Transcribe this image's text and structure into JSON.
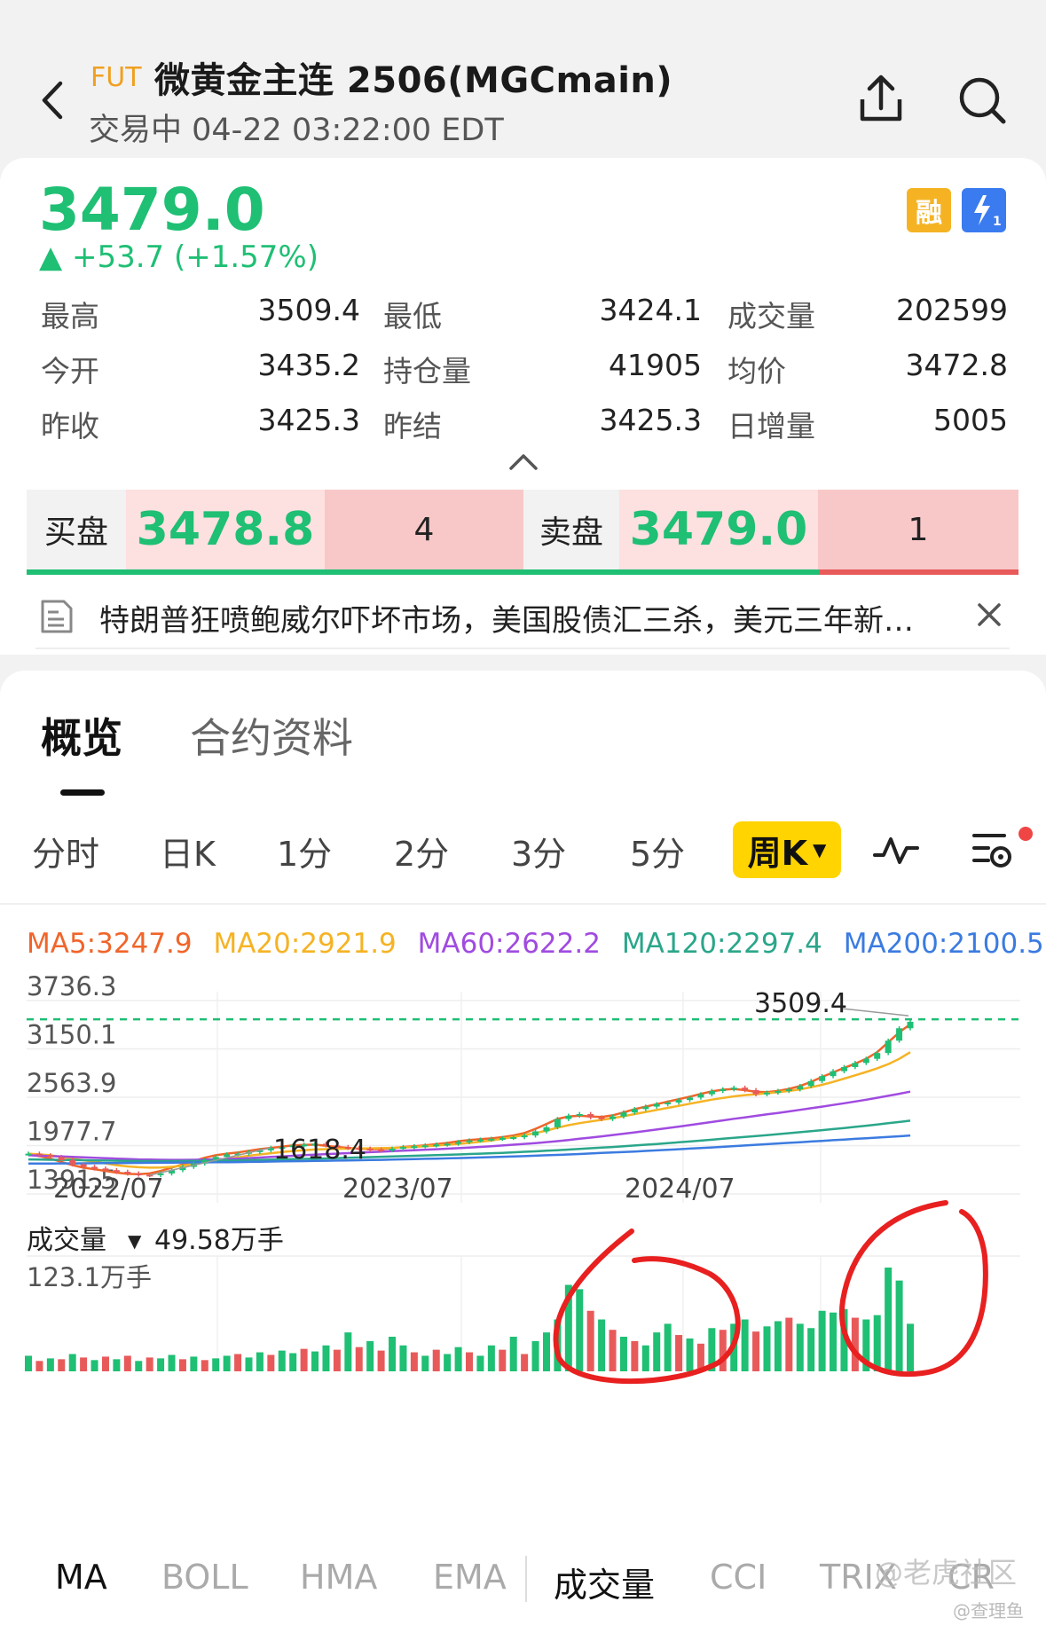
{
  "header": {
    "fut_badge": "FUT",
    "title": "微黄金主连 2506(MGCmain)",
    "status_line": "交易中 04-22 03:22:00 EDT"
  },
  "quote": {
    "last_price": "3479.0",
    "change": "▲ +53.7 (+1.57%)",
    "badge_rong": "融",
    "up_color": "#1fbf74",
    "down_color": "#e85a5a",
    "stats": [
      {
        "l1": "最高",
        "v1": "3509.4",
        "l2": "最低",
        "v2": "3424.1",
        "l3": "成交量",
        "v3": "202599"
      },
      {
        "l1": "今开",
        "v1": "3435.2",
        "l2": "持仓量",
        "v2": "41905",
        "l3": "均价",
        "v3": "3472.8"
      },
      {
        "l1": "昨收",
        "v1": "3425.3",
        "l2": "昨结",
        "v2": "3425.3",
        "l3": "日增量",
        "v3": "5005"
      }
    ]
  },
  "order_book": {
    "bid_label": "买盘",
    "bid_price": "3478.8",
    "bid_size": "4",
    "ask_label": "卖盘",
    "ask_price": "3479.0",
    "ask_size": "1"
  },
  "news": {
    "headline": "特朗普狂喷鲍威尔吓坏市场，美国股债汇三杀，美元三年新…"
  },
  "tabs": [
    "概览",
    "合约资料"
  ],
  "periods": [
    "分时",
    "日K",
    "1分",
    "2分",
    "3分",
    "5分"
  ],
  "active_period": "周K",
  "ma_legend": [
    {
      "text": "MA5:3247.9",
      "color": "#f0652a"
    },
    {
      "text": "MA20:2921.9",
      "color": "#f5b324"
    },
    {
      "text": "MA60:2622.2",
      "color": "#a04be0"
    },
    {
      "text": "MA120:2297.4",
      "color": "#2aa68a"
    },
    {
      "text": "MA200:2100.5",
      "color": "#3b7be0"
    }
  ],
  "chart_data": [
    {
      "type": "candlestick",
      "title": "",
      "y_ticks": [
        "3736.3",
        "3150.1",
        "2563.9",
        "1977.7",
        "1391.5"
      ],
      "ylim": [
        1391.5,
        3736.3
      ],
      "x_ticks": [
        "2022/07",
        "2023/07",
        "2024/07"
      ],
      "high_annotation": "3509.4",
      "low_annotation": "1618.4",
      "reference_line": 3509.4,
      "close_series": [
        1880,
        1860,
        1840,
        1800,
        1750,
        1720,
        1700,
        1680,
        1660,
        1640,
        1625,
        1620,
        1640,
        1680,
        1720,
        1760,
        1800,
        1840,
        1870,
        1880,
        1900,
        1920,
        1950,
        1960,
        1980,
        1990,
        2000,
        1980,
        1960,
        1950,
        1940,
        1930,
        1920,
        1940,
        1960,
        1970,
        1980,
        1990,
        2000,
        2020,
        2040,
        2050,
        2060,
        2070,
        2080,
        2100,
        2150,
        2200,
        2300,
        2340,
        2360,
        2320,
        2300,
        2330,
        2380,
        2420,
        2450,
        2480,
        2500,
        2530,
        2560,
        2600,
        2640,
        2660,
        2680,
        2650,
        2600,
        2620,
        2640,
        2660,
        2700,
        2760,
        2820,
        2880,
        2930,
        2980,
        3030,
        3100,
        3250,
        3400,
        3479
      ],
      "ma_series": [
        {
          "name": "MA5",
          "color": "#f0652a",
          "values": [
            1870,
            1850,
            1820,
            1780,
            1740,
            1710,
            1690,
            1670,
            1650,
            1635,
            1630,
            1640,
            1670,
            1710,
            1750,
            1790,
            1830,
            1860,
            1880,
            1895,
            1915,
            1935,
            1950,
            1965,
            1980,
            1985,
            1990,
            1975,
            1960,
            1950,
            1940,
            1935,
            1935,
            1945,
            1960,
            1970,
            1980,
            1995,
            2010,
            2030,
            2045,
            2055,
            2065,
            2080,
            2100,
            2130,
            2180,
            2240,
            2300,
            2330,
            2340,
            2330,
            2325,
            2345,
            2380,
            2420,
            2450,
            2480,
            2510,
            2540,
            2570,
            2605,
            2635,
            2655,
            2665,
            2650,
            2630,
            2625,
            2640,
            2665,
            2700,
            2750,
            2810,
            2865,
            2920,
            2970,
            3030,
            3110,
            3230,
            3350,
            3450
          ]
        },
        {
          "name": "MA20",
          "color": "#f5b324",
          "values": [
            1880,
            1870,
            1860,
            1840,
            1820,
            1800,
            1780,
            1760,
            1740,
            1725,
            1715,
            1710,
            1712,
            1720,
            1735,
            1755,
            1775,
            1795,
            1815,
            1835,
            1855,
            1870,
            1885,
            1900,
            1912,
            1922,
            1930,
            1935,
            1938,
            1940,
            1942,
            1944,
            1946,
            1950,
            1955,
            1962,
            1970,
            1978,
            1988,
            1998,
            2010,
            2025,
            2040,
            2060,
            2082,
            2105,
            2130,
            2160,
            2195,
            2225,
            2250,
            2270,
            2290,
            2310,
            2335,
            2360,
            2385,
            2410,
            2435,
            2460,
            2485,
            2510,
            2535,
            2555,
            2575,
            2590,
            2600,
            2612,
            2625,
            2640,
            2660,
            2685,
            2715,
            2750,
            2790,
            2830,
            2870,
            2915,
            2965,
            3030,
            3110
          ]
        },
        {
          "name": "MA60",
          "color": "#a04be0",
          "values": [
            1860,
            1855,
            1850,
            1845,
            1840,
            1835,
            1830,
            1825,
            1820,
            1815,
            1810,
            1808,
            1806,
            1805,
            1805,
            1806,
            1808,
            1811,
            1815,
            1820,
            1826,
            1833,
            1840,
            1847,
            1854,
            1861,
            1868,
            1874,
            1880,
            1886,
            1892,
            1898,
            1904,
            1910,
            1916,
            1922,
            1928,
            1934,
            1940,
            1947,
            1954,
            1962,
            1970,
            1979,
            1988,
            1998,
            2008,
            2020,
            2032,
            2046,
            2060,
            2075,
            2090,
            2106,
            2122,
            2138,
            2155,
            2172,
            2190,
            2208,
            2226,
            2245,
            2264,
            2283,
            2302,
            2320,
            2338,
            2356,
            2374,
            2392,
            2411,
            2430,
            2450,
            2470,
            2491,
            2512,
            2534,
            2557,
            2581,
            2606,
            2632
          ]
        },
        {
          "name": "MA120",
          "color": "#2aa68a",
          "values": [
            1810,
            1808,
            1806,
            1804,
            1802,
            1800,
            1798,
            1796,
            1794,
            1792,
            1791,
            1790,
            1790,
            1790,
            1791,
            1792,
            1793,
            1795,
            1797,
            1799,
            1801,
            1804,
            1807,
            1810,
            1813,
            1816,
            1819,
            1822,
            1826,
            1830,
            1834,
            1838,
            1842,
            1846,
            1850,
            1854,
            1858,
            1862,
            1866,
            1870,
            1875,
            1880,
            1885,
            1890,
            1896,
            1902,
            1908,
            1915,
            1922,
            1929,
            1937,
            1945,
            1953,
            1961,
            1970,
            1979,
            1988,
            1997,
            2007,
            2017,
            2027,
            2038,
            2049,
            2060,
            2071,
            2082,
            2093,
            2104,
            2116,
            2128,
            2140,
            2152,
            2165,
            2178,
            2191,
            2205,
            2219,
            2234,
            2249,
            2264,
            2280
          ]
        },
        {
          "name": "MA200",
          "color": "#3b7be0",
          "values": [
            1760,
            1760,
            1760,
            1761,
            1762,
            1763,
            1764,
            1765,
            1766,
            1767,
            1768,
            1769,
            1770,
            1771,
            1772,
            1773,
            1774,
            1775,
            1776,
            1778,
            1780,
            1782,
            1784,
            1786,
            1788,
            1790,
            1792,
            1794,
            1796,
            1798,
            1800,
            1802,
            1805,
            1808,
            1811,
            1814,
            1817,
            1820,
            1823,
            1826,
            1830,
            1834,
            1838,
            1842,
            1846,
            1850,
            1855,
            1860,
            1865,
            1870,
            1876,
            1882,
            1888,
            1894,
            1900,
            1906,
            1913,
            1920,
            1927,
            1934,
            1941,
            1948,
            1955,
            1963,
            1971,
            1979,
            1987,
            1995,
            2003,
            2011,
            2019,
            2027,
            2035,
            2043,
            2051,
            2059,
            2067,
            2075,
            2083,
            2091,
            2100
          ]
        }
      ]
    },
    {
      "type": "bar",
      "title": "成交量",
      "subtitle": "49.58万手",
      "y_ticks": [
        "123.1万手"
      ],
      "ylim": [
        0,
        123.1
      ],
      "unit": "万手",
      "up_color": "#1fbf74",
      "down_color": "#e85a5a",
      "values": [
        18,
        12,
        15,
        14,
        20,
        16,
        13,
        17,
        14,
        18,
        12,
        16,
        15,
        19,
        14,
        17,
        13,
        15,
        18,
        20,
        16,
        22,
        19,
        24,
        21,
        26,
        23,
        30,
        25,
        45,
        28,
        35,
        24,
        40,
        30,
        22,
        18,
        25,
        20,
        28,
        22,
        18,
        30,
        25,
        40,
        20,
        35,
        45,
        60,
        100,
        95,
        70,
        60,
        48,
        40,
        35,
        30,
        45,
        55,
        42,
        38,
        32,
        50,
        48,
        55,
        60,
        46,
        52,
        58,
        62,
        55,
        50,
        70,
        68,
        72,
        62,
        60,
        65,
        120,
        105,
        55
      ],
      "colors": [
        "g",
        "r",
        "g",
        "r",
        "g",
        "r",
        "g",
        "r",
        "g",
        "r",
        "g",
        "r",
        "g",
        "g",
        "r",
        "g",
        "r",
        "g",
        "g",
        "r",
        "g",
        "g",
        "r",
        "g",
        "g",
        "r",
        "g",
        "g",
        "r",
        "g",
        "r",
        "g",
        "r",
        "g",
        "g",
        "r",
        "g",
        "r",
        "g",
        "g",
        "r",
        "g",
        "g",
        "r",
        "g",
        "r",
        "g",
        "g",
        "g",
        "g",
        "g",
        "r",
        "g",
        "r",
        "g",
        "r",
        "g",
        "g",
        "g",
        "r",
        "g",
        "r",
        "g",
        "r",
        "g",
        "g",
        "r",
        "g",
        "g",
        "r",
        "g",
        "g",
        "g",
        "g",
        "g",
        "r",
        "g",
        "g",
        "g",
        "g",
        "g"
      ]
    }
  ],
  "indicators": [
    "MA",
    "BOLL",
    "HMA",
    "EMA",
    "成交量",
    "CCI",
    "TRIX",
    "CR"
  ],
  "watermark": "@老虎社区",
  "watermark2": "@查理鱼"
}
